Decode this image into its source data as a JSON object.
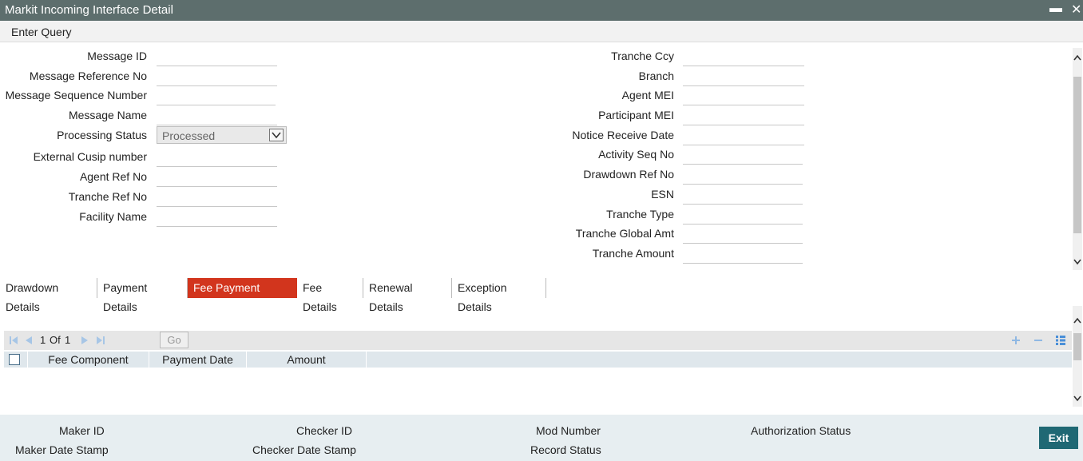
{
  "window": {
    "title": "Markit Incoming Interface Detail",
    "minimize_glyph": "▬",
    "close_glyph": "✕"
  },
  "menu": {
    "enter_query": "Enter Query"
  },
  "left_fields": [
    {
      "label": "Message ID",
      "value": ""
    },
    {
      "label": "Message Reference No",
      "value": ""
    },
    {
      "label": "Message Sequence Number",
      "value": ""
    },
    {
      "label": "Message Name",
      "value": ""
    },
    {
      "label": "Processing Status",
      "value": "Processed",
      "type": "select"
    },
    {
      "label": "External Cusip number",
      "value": ""
    },
    {
      "label": "Agent Ref No",
      "value": ""
    },
    {
      "label": "Tranche Ref No",
      "value": ""
    },
    {
      "label": "Facility Name",
      "value": ""
    }
  ],
  "right_fields": [
    {
      "label": "Tranche Ccy",
      "value": ""
    },
    {
      "label": "Branch",
      "value": ""
    },
    {
      "label": "Agent MEI",
      "value": ""
    },
    {
      "label": "Participant MEI",
      "value": ""
    },
    {
      "label": "Notice Receive Date",
      "value": ""
    },
    {
      "label": "Activity Seq No",
      "value": ""
    },
    {
      "label": "Drawdown Ref No",
      "value": ""
    },
    {
      "label": "ESN",
      "value": ""
    },
    {
      "label": "Tranche Type",
      "value": ""
    },
    {
      "label": "Tranche Global Amt",
      "value": ""
    },
    {
      "label": "Tranche Amount",
      "value": ""
    }
  ],
  "tabs": [
    {
      "label": "Drawdown Details",
      "active": false
    },
    {
      "label": "Payment Details",
      "active": false
    },
    {
      "label": "Fee Payment Details",
      "active": true
    },
    {
      "label": "Fee Details",
      "active": false
    },
    {
      "label": "Renewal Details",
      "active": false
    },
    {
      "label": "Exception Details",
      "active": false
    }
  ],
  "grid": {
    "page_current": "1",
    "page_of": "Of",
    "page_total": "1",
    "go_label": "Go",
    "columns": [
      "Fee Component",
      "Payment Date",
      "Amount"
    ],
    "rows": []
  },
  "footer": {
    "maker_id": "Maker ID",
    "maker_date_stamp": "Maker Date Stamp",
    "checker_id": "Checker ID",
    "checker_date_stamp": "Checker Date Stamp",
    "mod_number": "Mod Number",
    "record_status": "Record Status",
    "authorization_status": "Authorization Status",
    "exit_label": "Exit"
  },
  "colors": {
    "titlebar": "#5d6e6d",
    "active_tab": "#d2351d",
    "exit_button": "#1f6874",
    "grid_icons": "#4a8fd8"
  }
}
